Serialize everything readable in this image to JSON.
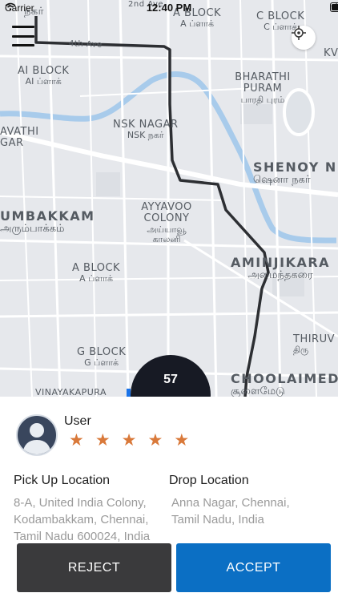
{
  "status_bar": {
    "carrier": "Carrier",
    "time": "12:40 PM"
  },
  "map": {
    "roads": [
      {
        "name": "4th Ave"
      },
      {
        "name": "2nd Ave"
      }
    ],
    "areas": [
      {
        "name": "நகர்",
        "subtitle": ""
      },
      {
        "name": "A BLOCK",
        "subtitle": "A ப்ளாக்"
      },
      {
        "name": "C BLOCK",
        "subtitle": "C ப்ளாக்"
      },
      {
        "name": "KV",
        "subtitle": ""
      },
      {
        "name": "AI BLOCK",
        "subtitle": "AI ப்ளாக்"
      },
      {
        "name": "BHARATHI PURAM",
        "subtitle": "பாரதி புரம்"
      },
      {
        "name": "NSK NAGAR",
        "subtitle": "NSK நகர்"
      },
      {
        "name": "AVATHI GAR",
        "subtitle": ""
      },
      {
        "name": "SHENOY N",
        "subtitle": "ஷெனா நகர்"
      },
      {
        "name": "AYYAVOO COLONY",
        "subtitle": "அய்யாவூ காலனி"
      },
      {
        "name": "UMBAKKAM",
        "subtitle": "அரும்பாக்கம்"
      },
      {
        "name": "A BLOCK",
        "subtitle": "A ப்ளாக்"
      },
      {
        "name": "AMINJIKARA",
        "subtitle": "அமைந்தகரை"
      },
      {
        "name": "THIRUV",
        "subtitle": "திரு"
      },
      {
        "name": "G BLOCK",
        "subtitle": "G ப்ளாக்"
      },
      {
        "name": "CHOOLAIMED",
        "subtitle": "சூளைமேடு"
      },
      {
        "name": "VINAYAKAPURA",
        "subtitle": ""
      }
    ],
    "colors": {
      "background": "#e6e8ec",
      "water": "#a8cbeb",
      "route": "#2d2f33",
      "road": "#ffffff"
    }
  },
  "timer": {
    "value": "57"
  },
  "rider": {
    "name": "User",
    "rating": 5,
    "rating_max": 5
  },
  "pickup": {
    "title": "Pick Up Location",
    "address": "8-A, United India Colony, Kodambakkam, Chennai, Tamil Nadu 600024, India"
  },
  "drop": {
    "title": "Drop Location",
    "address": "Anna Nagar, Chennai, Tamil Nadu, India"
  },
  "actions": {
    "reject_label": "REJECT",
    "accept_label": "ACCEPT"
  },
  "colors": {
    "reject": "#3a3a3c",
    "accept": "#0b6fc4",
    "star": "#d9793a",
    "timer_bg": "#171a24"
  },
  "icons": [
    "wifi-icon",
    "location-arrow-icon",
    "battery-icon",
    "menu-icon",
    "locate-icon",
    "user-avatar-icon",
    "star-icon"
  ]
}
